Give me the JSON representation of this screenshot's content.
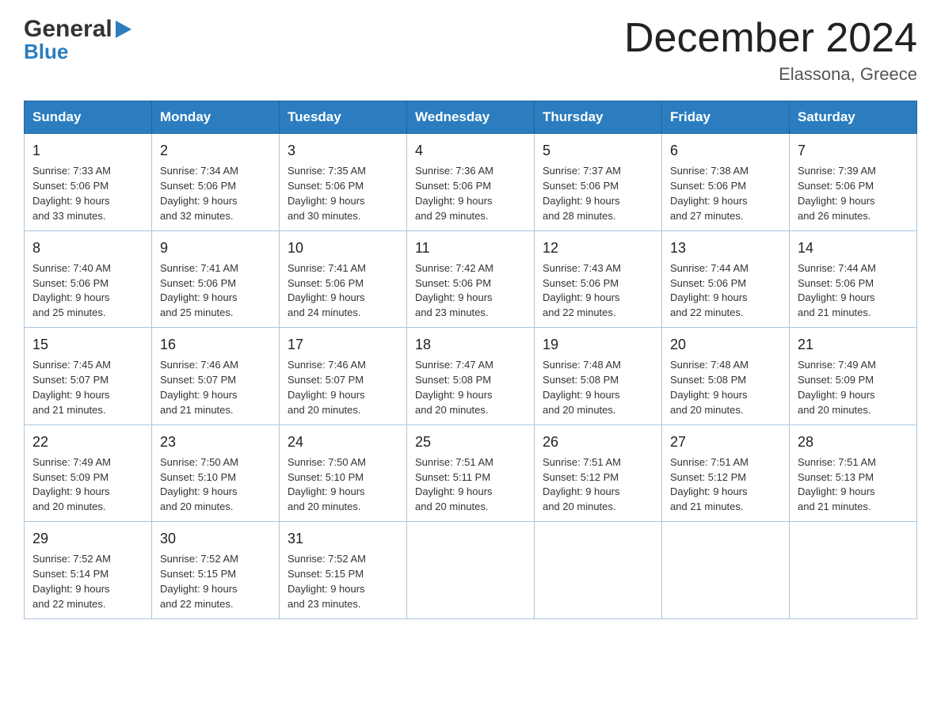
{
  "header": {
    "logo_general": "General",
    "logo_blue": "Blue",
    "title": "December 2024",
    "subtitle": "Elassona, Greece"
  },
  "calendar": {
    "days_of_week": [
      "Sunday",
      "Monday",
      "Tuesday",
      "Wednesday",
      "Thursday",
      "Friday",
      "Saturday"
    ],
    "weeks": [
      [
        {
          "day": "1",
          "sunrise": "7:33 AM",
          "sunset": "5:06 PM",
          "daylight": "9 hours and 33 minutes."
        },
        {
          "day": "2",
          "sunrise": "7:34 AM",
          "sunset": "5:06 PM",
          "daylight": "9 hours and 32 minutes."
        },
        {
          "day": "3",
          "sunrise": "7:35 AM",
          "sunset": "5:06 PM",
          "daylight": "9 hours and 30 minutes."
        },
        {
          "day": "4",
          "sunrise": "7:36 AM",
          "sunset": "5:06 PM",
          "daylight": "9 hours and 29 minutes."
        },
        {
          "day": "5",
          "sunrise": "7:37 AM",
          "sunset": "5:06 PM",
          "daylight": "9 hours and 28 minutes."
        },
        {
          "day": "6",
          "sunrise": "7:38 AM",
          "sunset": "5:06 PM",
          "daylight": "9 hours and 27 minutes."
        },
        {
          "day": "7",
          "sunrise": "7:39 AM",
          "sunset": "5:06 PM",
          "daylight": "9 hours and 26 minutes."
        }
      ],
      [
        {
          "day": "8",
          "sunrise": "7:40 AM",
          "sunset": "5:06 PM",
          "daylight": "9 hours and 25 minutes."
        },
        {
          "day": "9",
          "sunrise": "7:41 AM",
          "sunset": "5:06 PM",
          "daylight": "9 hours and 25 minutes."
        },
        {
          "day": "10",
          "sunrise": "7:41 AM",
          "sunset": "5:06 PM",
          "daylight": "9 hours and 24 minutes."
        },
        {
          "day": "11",
          "sunrise": "7:42 AM",
          "sunset": "5:06 PM",
          "daylight": "9 hours and 23 minutes."
        },
        {
          "day": "12",
          "sunrise": "7:43 AM",
          "sunset": "5:06 PM",
          "daylight": "9 hours and 22 minutes."
        },
        {
          "day": "13",
          "sunrise": "7:44 AM",
          "sunset": "5:06 PM",
          "daylight": "9 hours and 22 minutes."
        },
        {
          "day": "14",
          "sunrise": "7:44 AM",
          "sunset": "5:06 PM",
          "daylight": "9 hours and 21 minutes."
        }
      ],
      [
        {
          "day": "15",
          "sunrise": "7:45 AM",
          "sunset": "5:07 PM",
          "daylight": "9 hours and 21 minutes."
        },
        {
          "day": "16",
          "sunrise": "7:46 AM",
          "sunset": "5:07 PM",
          "daylight": "9 hours and 21 minutes."
        },
        {
          "day": "17",
          "sunrise": "7:46 AM",
          "sunset": "5:07 PM",
          "daylight": "9 hours and 20 minutes."
        },
        {
          "day": "18",
          "sunrise": "7:47 AM",
          "sunset": "5:08 PM",
          "daylight": "9 hours and 20 minutes."
        },
        {
          "day": "19",
          "sunrise": "7:48 AM",
          "sunset": "5:08 PM",
          "daylight": "9 hours and 20 minutes."
        },
        {
          "day": "20",
          "sunrise": "7:48 AM",
          "sunset": "5:08 PM",
          "daylight": "9 hours and 20 minutes."
        },
        {
          "day": "21",
          "sunrise": "7:49 AM",
          "sunset": "5:09 PM",
          "daylight": "9 hours and 20 minutes."
        }
      ],
      [
        {
          "day": "22",
          "sunrise": "7:49 AM",
          "sunset": "5:09 PM",
          "daylight": "9 hours and 20 minutes."
        },
        {
          "day": "23",
          "sunrise": "7:50 AM",
          "sunset": "5:10 PM",
          "daylight": "9 hours and 20 minutes."
        },
        {
          "day": "24",
          "sunrise": "7:50 AM",
          "sunset": "5:10 PM",
          "daylight": "9 hours and 20 minutes."
        },
        {
          "day": "25",
          "sunrise": "7:51 AM",
          "sunset": "5:11 PM",
          "daylight": "9 hours and 20 minutes."
        },
        {
          "day": "26",
          "sunrise": "7:51 AM",
          "sunset": "5:12 PM",
          "daylight": "9 hours and 20 minutes."
        },
        {
          "day": "27",
          "sunrise": "7:51 AM",
          "sunset": "5:12 PM",
          "daylight": "9 hours and 21 minutes."
        },
        {
          "day": "28",
          "sunrise": "7:51 AM",
          "sunset": "5:13 PM",
          "daylight": "9 hours and 21 minutes."
        }
      ],
      [
        {
          "day": "29",
          "sunrise": "7:52 AM",
          "sunset": "5:14 PM",
          "daylight": "9 hours and 22 minutes."
        },
        {
          "day": "30",
          "sunrise": "7:52 AM",
          "sunset": "5:15 PM",
          "daylight": "9 hours and 22 minutes."
        },
        {
          "day": "31",
          "sunrise": "7:52 AM",
          "sunset": "5:15 PM",
          "daylight": "9 hours and 23 minutes."
        },
        null,
        null,
        null,
        null
      ]
    ],
    "labels": {
      "sunrise": "Sunrise:",
      "sunset": "Sunset:",
      "daylight": "Daylight:"
    }
  }
}
